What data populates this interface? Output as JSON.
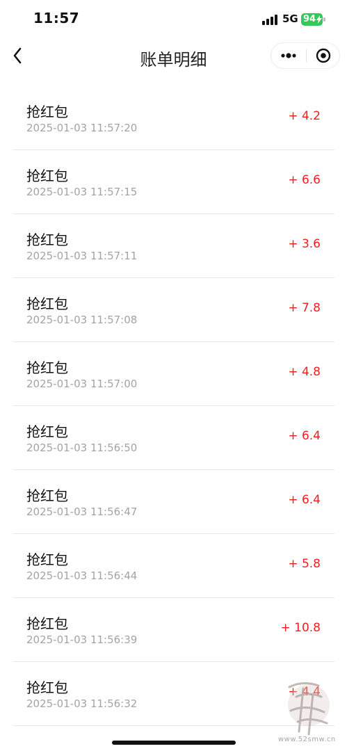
{
  "status_bar": {
    "time": "11:57",
    "network": "5G",
    "battery": "94"
  },
  "nav": {
    "title": "账单明细",
    "back_icon": "chevron-left-icon",
    "more_icon": "more-dots-icon",
    "close_icon": "target-circle-icon"
  },
  "transactions": [
    {
      "title": "抢红包",
      "time": "2025-01-03 11:57:20",
      "amount": "+ 4.2"
    },
    {
      "title": "抢红包",
      "time": "2025-01-03 11:57:15",
      "amount": "+ 6.6"
    },
    {
      "title": "抢红包",
      "time": "2025-01-03 11:57:11",
      "amount": "+ 3.6"
    },
    {
      "title": "抢红包",
      "time": "2025-01-03 11:57:08",
      "amount": "+ 7.8"
    },
    {
      "title": "抢红包",
      "time": "2025-01-03 11:57:00",
      "amount": "+ 4.8"
    },
    {
      "title": "抢红包",
      "time": "2025-01-03 11:56:50",
      "amount": "+ 6.4"
    },
    {
      "title": "抢红包",
      "time": "2025-01-03 11:56:47",
      "amount": "+ 6.4"
    },
    {
      "title": "抢红包",
      "time": "2025-01-03 11:56:44",
      "amount": "+ 5.8"
    },
    {
      "title": "抢红包",
      "time": "2025-01-03 11:56:39",
      "amount": "+ 10.8"
    },
    {
      "title": "抢红包",
      "time": "2025-01-03 11:56:32",
      "amount": "+ 4.4"
    }
  ],
  "watermark": {
    "site": "www.52smw.cn"
  },
  "colors": {
    "amount": "#f01f1f",
    "battery": "#34c759",
    "timestamp": "#a3a3a3"
  }
}
